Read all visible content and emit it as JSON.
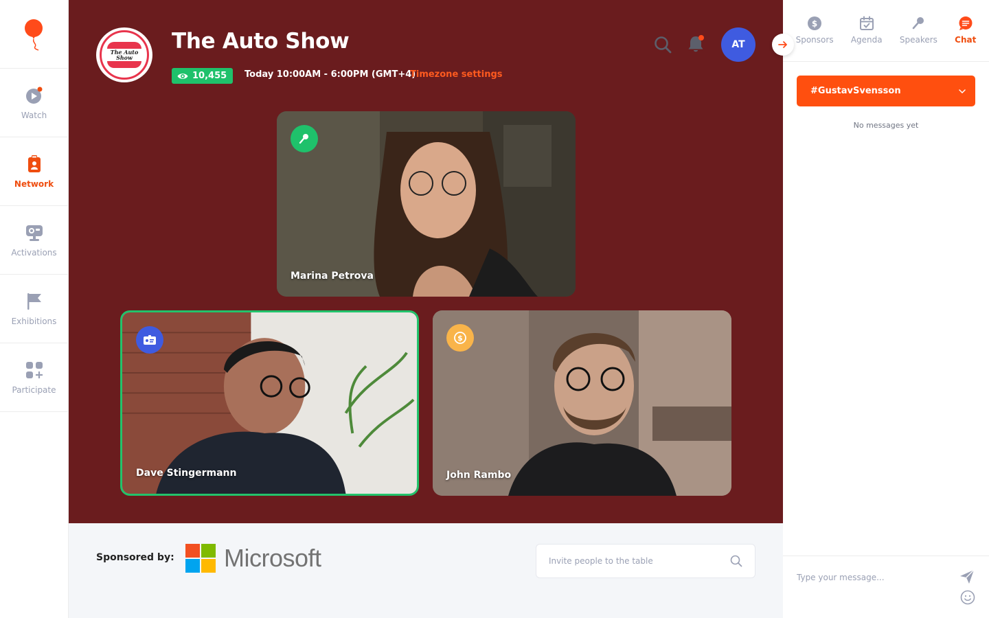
{
  "nav": {
    "items": [
      {
        "label": "Watch",
        "icon": "play-icon"
      },
      {
        "label": "Network",
        "icon": "badge-icon",
        "active": true
      },
      {
        "label": "Activations",
        "icon": "video-booth-icon"
      },
      {
        "label": "Exhibitions",
        "icon": "flag-icon"
      },
      {
        "label": "Participate",
        "icon": "grid-plus-icon"
      }
    ]
  },
  "event": {
    "logo_text": "The Auto Show",
    "title": "The Auto Show",
    "viewers": "10,455",
    "schedule": "Today 10:00AM - 6:00PM (GMT+4)",
    "timezone_link": "Timezone settings"
  },
  "header": {
    "avatar_initials": "AT"
  },
  "participants": [
    {
      "name": "Marina Petrova",
      "role_icon": "microphone-icon",
      "role_color": "#1fc16b"
    },
    {
      "name": "Dave Stingermann",
      "role_icon": "id-card-icon",
      "role_color": "#3f5be0",
      "selected": true
    },
    {
      "name": "John Rambo",
      "role_icon": "dollar-icon",
      "role_color": "#f9b44a"
    }
  ],
  "footer": {
    "sponsored_label": "Sponsored by:",
    "sponsor_name": "Microsoft",
    "invite_placeholder": "Invite people to the table"
  },
  "panel": {
    "tabs": [
      {
        "label": "Sponsors",
        "icon": "dollar-circle-icon"
      },
      {
        "label": "Agenda",
        "icon": "calendar-icon"
      },
      {
        "label": "Speakers",
        "icon": "microphone-icon"
      },
      {
        "label": "Chat",
        "icon": "chat-icon",
        "active": true
      }
    ],
    "channel": "#GustavSvensson",
    "empty_text": "No messages yet",
    "message_placeholder": "Type your message..."
  },
  "colors": {
    "accent": "#ef4d0f",
    "stage_bg": "#6a1c1e",
    "viewers_badge": "#1fc16b",
    "avatar": "#3f5be0"
  }
}
